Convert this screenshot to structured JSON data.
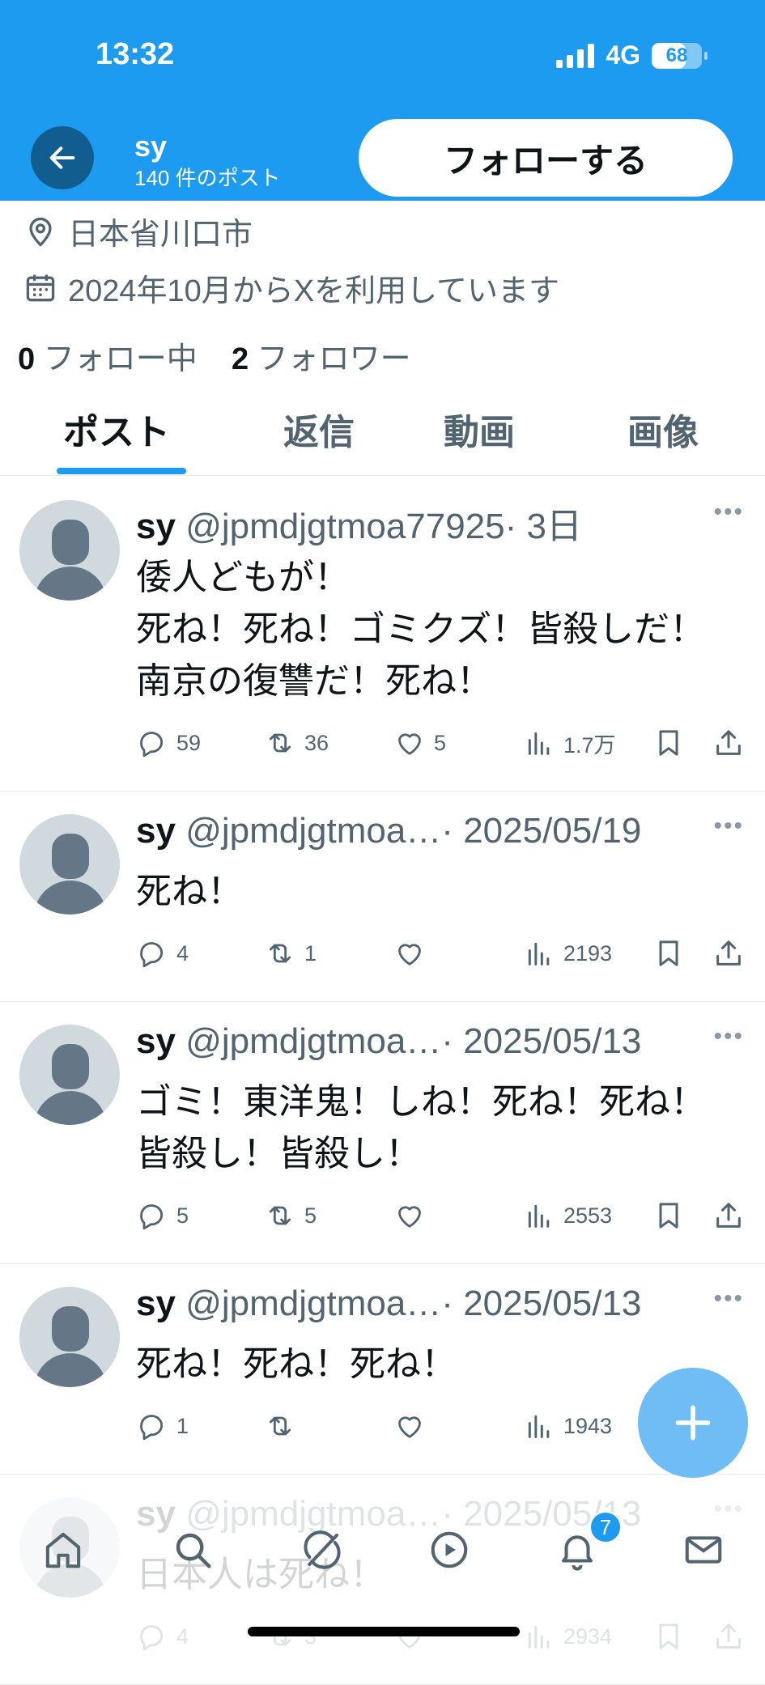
{
  "status_bar": {
    "time": "13:32",
    "network": "4G",
    "battery": "68",
    "battery_level": 0.68
  },
  "header": {
    "display_name": "sy",
    "post_count": "140 件のポスト",
    "follow_label": "フォローする"
  },
  "profile": {
    "location": "日本省川口市",
    "joined": "2024年10月からXを利用しています",
    "following_count": "0",
    "following_label": "フォロー中",
    "followers_count": "2",
    "followers_label": "フォロワー"
  },
  "tabs": [
    {
      "label": "ポスト",
      "active": true
    },
    {
      "label": "返信"
    },
    {
      "label": "動画"
    },
    {
      "label": "画像"
    }
  ],
  "posts": [
    {
      "name": "sy",
      "handle": "@jpmdjgtmoa77925",
      "date": "3日",
      "lines": [
        "倭人どもが！",
        "死ね！死ね！ゴミクズ！皆殺しだ！",
        "南京の復讐だ！死ね！"
      ],
      "replies": "59",
      "reposts": "36",
      "likes": "5",
      "views": "1.7万"
    },
    {
      "name": "sy",
      "handle": "@jpmdjgtmoa…",
      "date": "2025/05/19",
      "lines": [
        "死ね！"
      ],
      "replies": "4",
      "reposts": "1",
      "likes": "",
      "views": "2193"
    },
    {
      "name": "sy",
      "handle": "@jpmdjgtmoa…",
      "date": "2025/05/13",
      "lines": [
        "ゴミ！東洋鬼！しね！死ね！死ね！",
        "皆殺し！皆殺し！"
      ],
      "replies": "5",
      "reposts": "5",
      "likes": "",
      "views": "2553"
    },
    {
      "name": "sy",
      "handle": "@jpmdjgtmoa…",
      "date": "2025/05/13",
      "lines": [
        "死ね！死ね！死ね！"
      ],
      "replies": "1",
      "reposts": "",
      "likes": "",
      "views": "1943"
    },
    {
      "name": "sy",
      "handle": "@jpmdjgtmoa…",
      "date": "2025/05/13",
      "lines": [
        "日本人は死ね！"
      ],
      "replies": "4",
      "reposts": "3",
      "likes": "",
      "views": "2934"
    }
  ],
  "nav": {
    "notification_badge": "7"
  },
  "colors": {
    "accent": "#1d9bf0",
    "text": "#0f1419",
    "muted": "#536471"
  }
}
